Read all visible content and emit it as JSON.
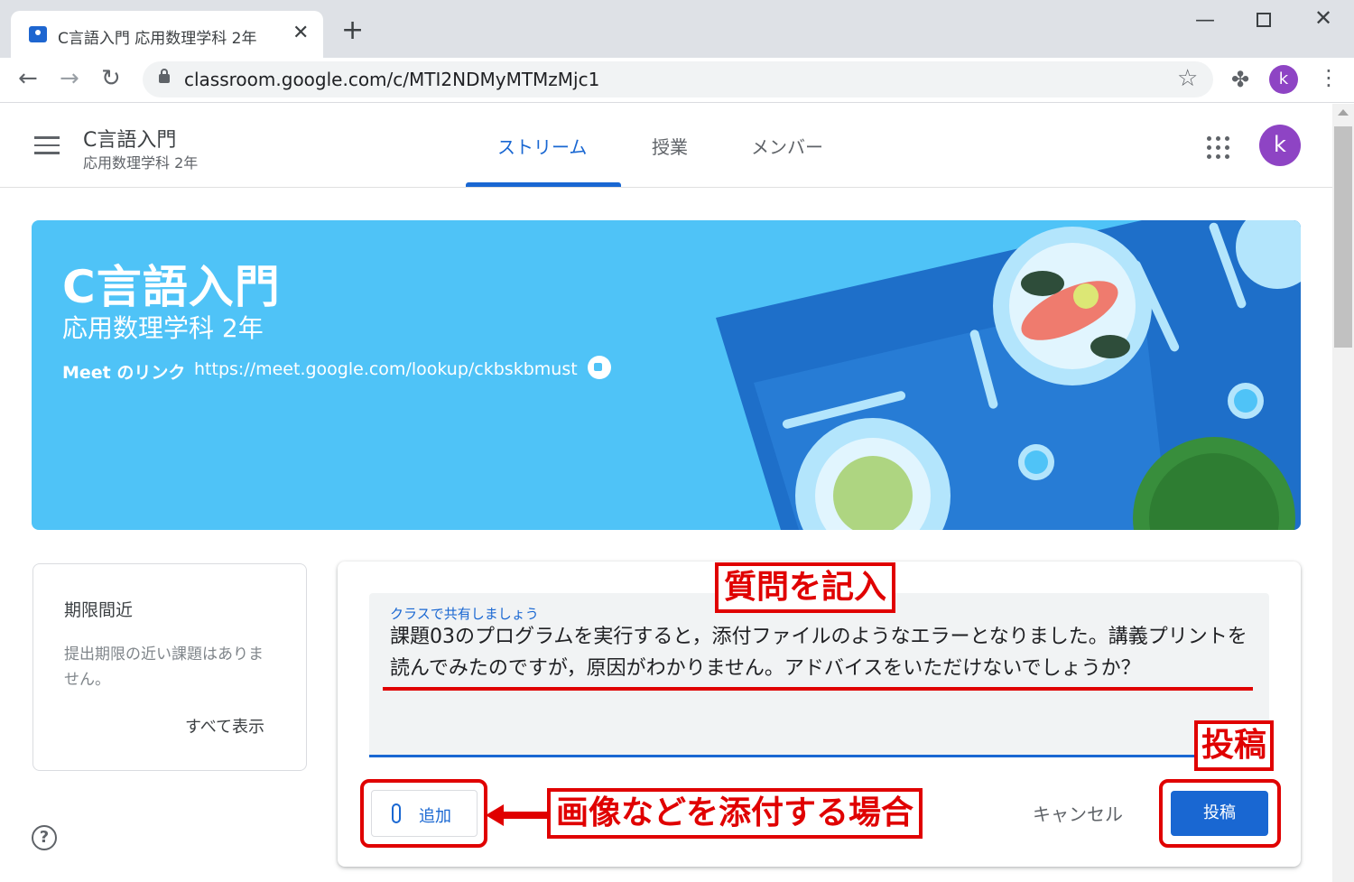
{
  "browser": {
    "tab_title": "C言語入門 応用数理学科 2年",
    "url": "classroom.google.com/c/MTI2NDMyMTMzMjc1",
    "profile_initial": "k"
  },
  "header": {
    "class_name": "C言語入門",
    "class_section": "応用数理学科 2年",
    "tabs": [
      {
        "label": "ストリーム",
        "active": true
      },
      {
        "label": "授業",
        "active": false
      },
      {
        "label": "メンバー",
        "active": false
      }
    ],
    "user_initial": "k"
  },
  "banner": {
    "title": "C言語入門",
    "section": "応用数理学科 2年",
    "meet_label": "Meet のリンク",
    "meet_url": "https://meet.google.com/lookup/ckbskbmust"
  },
  "upcoming": {
    "title": "期限間近",
    "empty_text": "提出期限の近い課題はありません。",
    "view_all": "すべて表示"
  },
  "composer": {
    "label": "クラスで共有しましょう",
    "text": "課題03のプログラムを実行すると，添付ファイルのようなエラーとなりました。講義プリントを読んでみたのですが，原因がわかりません。アドバイスをいただけないでしょうか？",
    "add_label": "追加",
    "cancel_label": "キャンセル",
    "post_label": "投稿"
  },
  "annotations": {
    "question": "質問を記入",
    "post": "投稿",
    "attach": "画像などを添付する場合"
  },
  "colors": {
    "accent": "#1967d2",
    "banner": "#4fc3f7",
    "annotation": "#e00000",
    "avatar": "#8e44c4"
  }
}
